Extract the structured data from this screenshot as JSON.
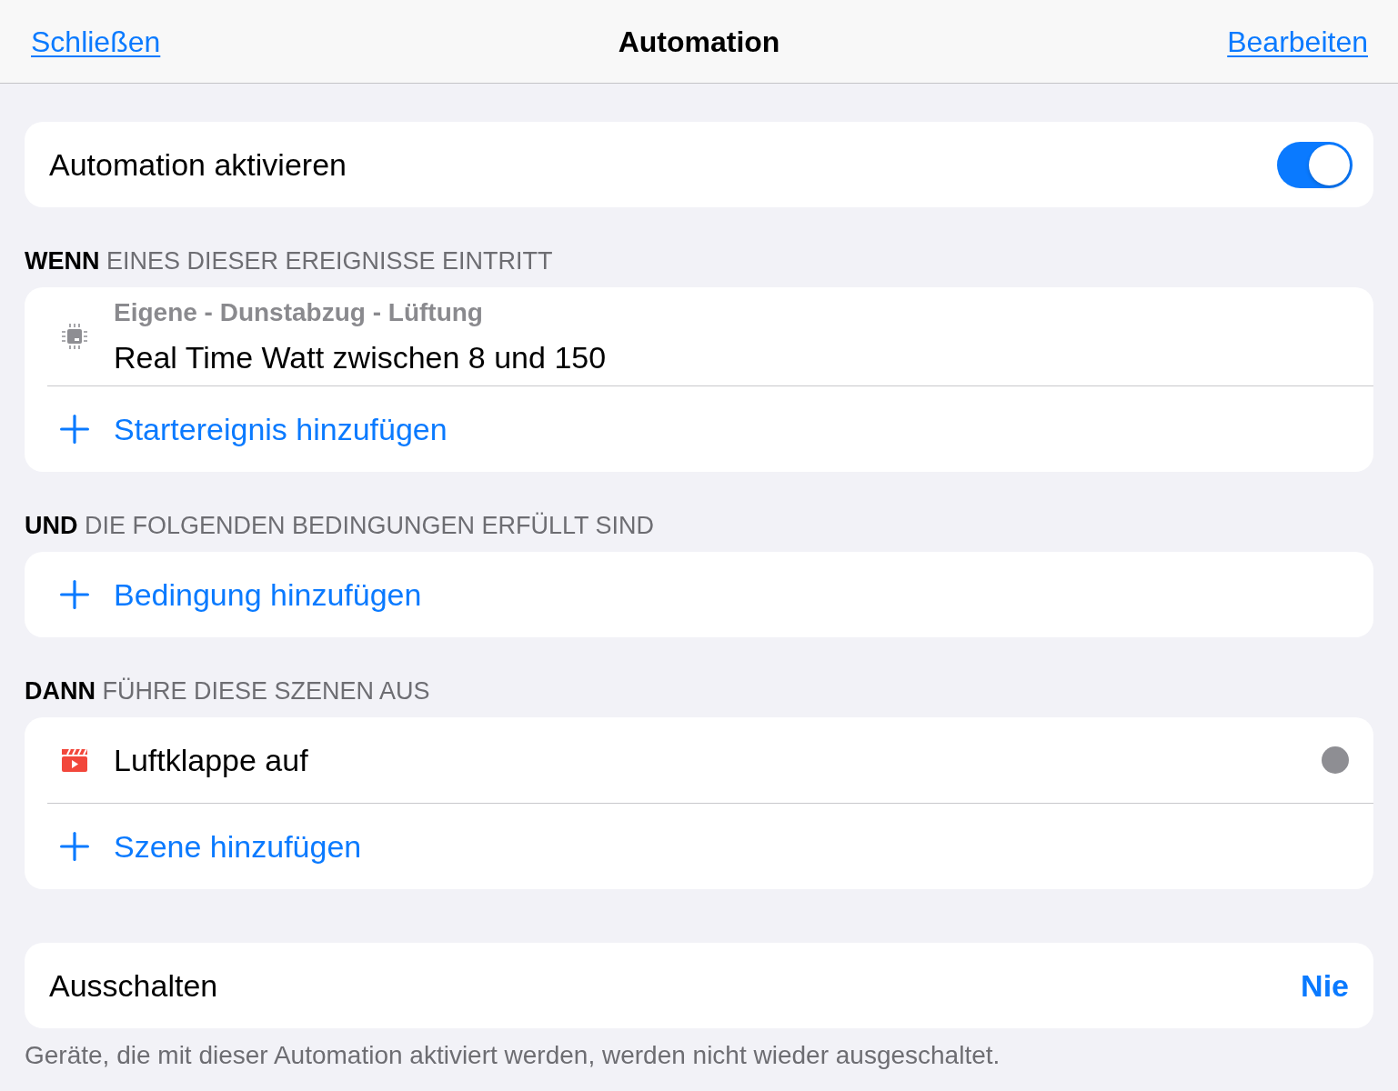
{
  "navigation": {
    "close": "Schließen",
    "title": "Automation",
    "edit": "Bearbeiten"
  },
  "enable": {
    "label": "Automation aktivieren",
    "on": true
  },
  "sections": [
    {
      "heading": "**WENN** EINES DIESER EREIGNISSE EINTRITT",
      "items": [
        {
          "kind": "device",
          "title": "Eigene - Dunstabzug - Lüftung",
          "label": "Real Time Watt zwischen 8 und 150"
        }
      ],
      "add_label": "Startereignis hinzufügen"
    },
    {
      "heading": "**UND** DIE FOLGENDEN BEDINGUNGEN ERFÜLLT SIND",
      "add_label": "Bedingung hinzufügen"
    },
    {
      "heading": "**DANN** FÜHRE DIESE SZENEN AUS",
      "items": [
        {
          "kind": "scene",
          "label": "Luftklappe auf"
        }
      ],
      "add_label": "Szene hinzufügen"
    }
  ],
  "turn_off": {
    "label": "Ausschalten",
    "value": "Nie"
  },
  "footnote": "Geräte, die mit dieser Automation aktiviert werden, werden nicht wieder ausgeschaltet."
}
